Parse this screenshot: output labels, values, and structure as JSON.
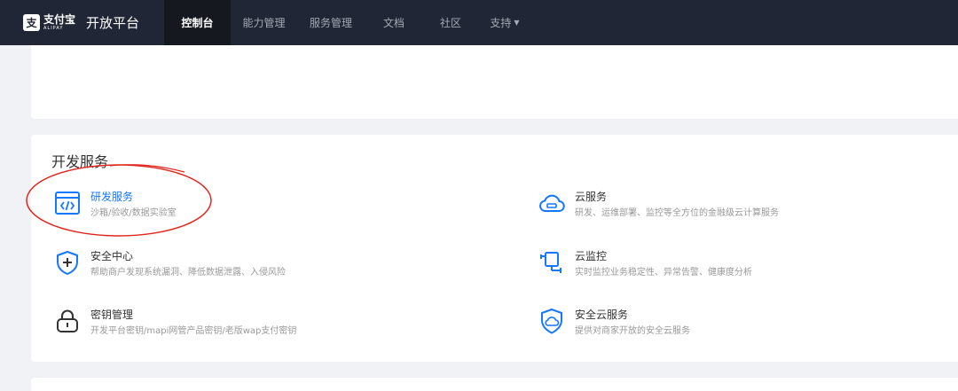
{
  "brand": {
    "mark": "支",
    "name_cn": "支付宝",
    "name_en": "ALIPAY",
    "platform": "开放平台"
  },
  "nav": {
    "items": [
      {
        "label": "控制台",
        "active": true
      },
      {
        "label": "能力管理"
      },
      {
        "label": "服务管理"
      },
      {
        "label": "文档"
      },
      {
        "label": "社区"
      },
      {
        "label": "支持"
      }
    ]
  },
  "section": {
    "title": "开发服务",
    "services": [
      {
        "name": "研发服务",
        "desc": "沙箱/验收/数据实验室",
        "icon": "code-window-icon"
      },
      {
        "name": "云服务",
        "desc": "研发、运维部署、监控等全方位的金融级云计算服务",
        "icon": "cloud-icon"
      },
      {
        "name": "安全中心",
        "desc": "帮助商户发现系统漏洞、降低数据泄露、入侵风险",
        "icon": "shield-plus-icon"
      },
      {
        "name": "云监控",
        "desc": "实时监控业务稳定性、异常告警、健康度分析",
        "icon": "monitor-icon"
      },
      {
        "name": "密钥管理",
        "desc": "开发平台密钥/mapi网管产品密钥/老版wap支付密钥",
        "icon": "lock-icon"
      },
      {
        "name": "安全云服务",
        "desc": "提供对商家开放的安全云服务",
        "icon": "shield-cloud-icon"
      }
    ]
  },
  "colors": {
    "topbar": "#212636",
    "nav_active": "#15191f",
    "accent": "#1677ff",
    "annotation": "#e0281f"
  }
}
